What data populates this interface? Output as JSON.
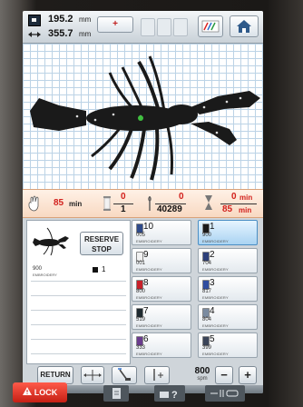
{
  "topbar": {
    "width_value": "195.2",
    "width_unit": "mm",
    "height_value": "355.7",
    "height_unit": "mm",
    "center_button_label": "+",
    "thread_icon": "thread-color-icon",
    "home_icon": "home-icon"
  },
  "infobar": {
    "time_remaining": "85",
    "time_unit": "min",
    "color_count_done": "0",
    "color_count_total": "1",
    "stitch_done": "0",
    "stitch_total": "40289",
    "timer_done": "0",
    "timer_done_unit": "min",
    "timer_total": "85",
    "timer_total_unit": "min"
  },
  "left_panel": {
    "reserve_stop_label": "RESERVE STOP",
    "thread_code": "900",
    "thread_brand": "EMBROIDERY",
    "thread_number": "1"
  },
  "thread_list": [
    {
      "num": "10",
      "code": "005",
      "brand": "EMBROIDERY",
      "color": "#2e4a8a",
      "active": false
    },
    {
      "num": "1",
      "code": "900",
      "brand": "EMBROIDERY",
      "color": "#1a1a1a",
      "active": true
    },
    {
      "num": "9",
      "code": "001",
      "brand": "EMBROIDERY",
      "color": "#f2f2f2",
      "active": false
    },
    {
      "num": "2",
      "code": "704",
      "brand": "EMBROIDERY",
      "color": "#2c3f7a",
      "active": false
    },
    {
      "num": "8",
      "code": "800",
      "brand": "EMBROIDERY",
      "color": "#c8202a",
      "active": false
    },
    {
      "num": "3",
      "code": "817",
      "brand": "EMBROIDERY",
      "color": "#2f4da0",
      "active": false
    },
    {
      "num": "7",
      "code": "519",
      "brand": "EMBROIDERY",
      "color": "#1f2a30",
      "active": false
    },
    {
      "num": "4",
      "code": "804",
      "brand": "EMBROIDERY",
      "color": "#7a8ba0",
      "active": false
    },
    {
      "num": "6",
      "code": "333",
      "brand": "EMBROIDERY",
      "color": "#6b3c8e",
      "active": false
    },
    {
      "num": "5",
      "code": "399",
      "brand": "EMBROIDERY",
      "color": "#3a4458",
      "active": false
    }
  ],
  "controls": {
    "return_label": "RETURN",
    "speed_value": "800",
    "speed_unit": "spm",
    "minus_label": "−",
    "plus_label": "+"
  },
  "footer": {
    "lock_label": "LOCK",
    "lock_icon": "warning-icon"
  },
  "colors": {
    "accent_red": "#d2201c",
    "active_blue": "#4a8ec4",
    "infobar_bg": "#f8d9c2"
  }
}
